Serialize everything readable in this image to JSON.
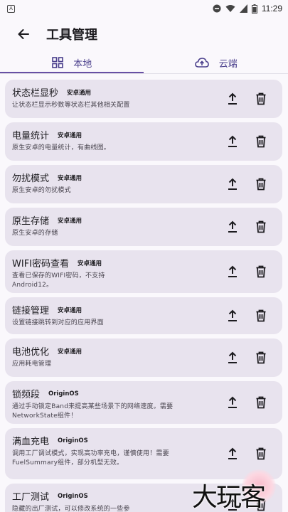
{
  "status_bar": {
    "time": "11:29",
    "app_badge": "A"
  },
  "app_bar": {
    "title": "工具管理"
  },
  "tabs": [
    {
      "label": "本地",
      "icon": "grid-icon",
      "selected": true
    },
    {
      "label": "云端",
      "icon": "cloud-upload-icon",
      "selected": false
    }
  ],
  "tools": [
    {
      "name": "状态栏显秒",
      "badge": "安卓通用",
      "desc": "让状态栏显示秒数等状态栏其他相关配置"
    },
    {
      "name": "电量统计",
      "badge": "安卓通用",
      "desc": "原生安卓的电量统计，有曲线图。"
    },
    {
      "name": "勿扰模式",
      "badge": "安卓通用",
      "desc": "原生安卓的勿扰模式"
    },
    {
      "name": "原生存储",
      "badge": "安卓通用",
      "desc": "原生安卓的存储"
    },
    {
      "name": "WIFI密码查看",
      "badge": "安卓通用",
      "desc": "查看已保存的WIFI密码，不支持Android12。"
    },
    {
      "name": "链接管理",
      "badge": "安卓通用",
      "desc": "设置链接跳转到对应的应用界面"
    },
    {
      "name": "电池优化",
      "badge": "安卓通用",
      "desc": "应用耗电管理"
    },
    {
      "name": "锁频段",
      "badge": "OriginOS",
      "desc": "通过手动锁定Band来提高某些场景下的网络速度。需要NetworkState组件！"
    },
    {
      "name": "满血充电",
      "badge": "OriginOS",
      "desc": "调用工厂调试模式，实现高功率充电，谨慎使用！需要FuelSummary组件，部分机型无效。"
    },
    {
      "name": "工厂测试",
      "badge": "OriginOS",
      "desc": "隐藏的出厂测试，可以修改系统的一些参"
    }
  ],
  "actions": {
    "upload_icon": "upload-icon",
    "delete_icon": "trash-icon"
  },
  "watermark": {
    "text": "大玩客"
  },
  "colors": {
    "accent": "#6750a4",
    "card": "#e8e3ee",
    "background": "#faf8fc"
  }
}
